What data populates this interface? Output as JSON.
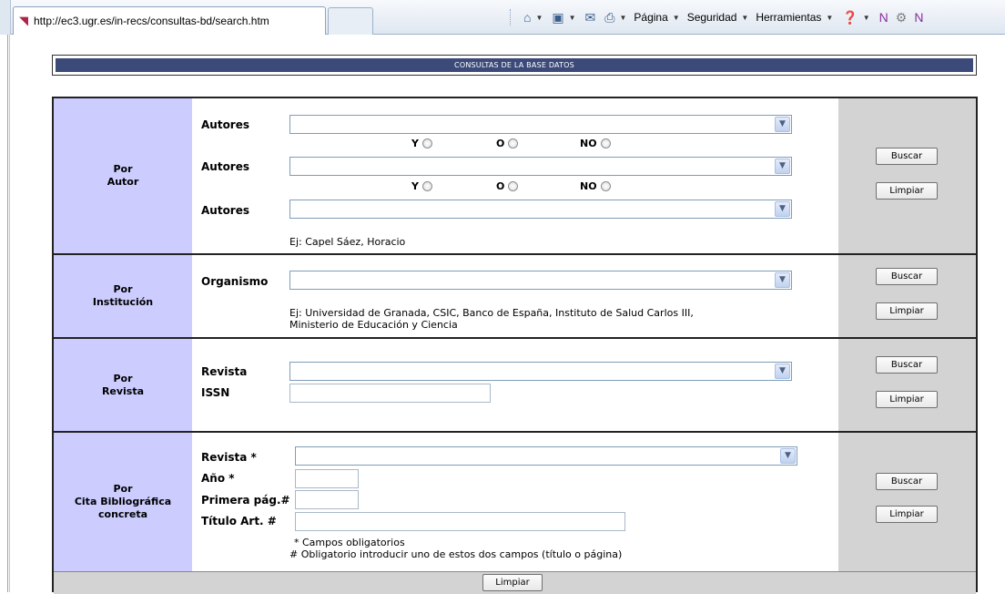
{
  "browser": {
    "tab_url": "http://ec3.ugr.es/in-recs/consultas-bd/search.htm",
    "menu": {
      "pagina": "Página",
      "seguridad": "Seguridad",
      "herramientas": "Herramientas"
    }
  },
  "header": {
    "title": "Consultas de la base datos"
  },
  "autor": {
    "category_line1": "Por",
    "category_line2": "Autor",
    "field_label": "Autores",
    "conn_y": "Y",
    "conn_o": "O",
    "conn_no": "NO",
    "example": "Ej: Capel Sáez, Horacio",
    "search_btn": "Buscar",
    "clear_btn": "Limpiar"
  },
  "institucion": {
    "category_line1": "Por",
    "category_line2": "Institución",
    "field_label": "Organismo",
    "example_line1": "Ej: Universidad de Granada, CSIC, Banco de España, Instituto de Salud Carlos III,",
    "example_line2": "Ministerio de Educación y Ciencia",
    "search_btn": "Buscar",
    "clear_btn": "Limpiar"
  },
  "revista": {
    "category_line1": "Por",
    "category_line2": "Revista",
    "field_revista": "Revista",
    "field_issn": "ISSN",
    "search_btn": "Buscar",
    "clear_btn": "Limpiar"
  },
  "cita": {
    "category_line1": "Por",
    "category_line2": "Cita Bibliográfica",
    "category_line3": "concreta",
    "field_revista": "Revista *",
    "field_anio": "Año *",
    "field_pagina": "Primera pág.#",
    "field_titulo": "Título  Art. #",
    "note1": "* Campos obligatorios",
    "note2": "# Obligatorio introducir uno de estos dos campos (título o página)",
    "search_btn": "Buscar",
    "clear_btn": "Limpiar"
  },
  "footer": {
    "clear_all_btn": "Limpiar"
  }
}
